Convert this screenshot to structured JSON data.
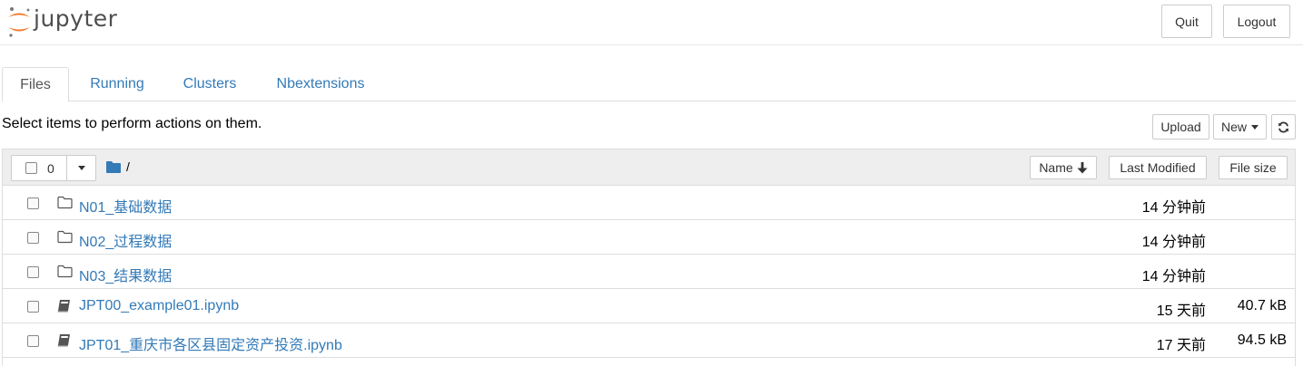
{
  "app": {
    "logo_text": "jupyter",
    "colors": {
      "logo_orange": "#f37726",
      "logo_gray": "#767677",
      "link_blue": "#337ab7"
    }
  },
  "header": {
    "quit_label": "Quit",
    "logout_label": "Logout"
  },
  "tabs": [
    {
      "label": "Files",
      "active": true
    },
    {
      "label": "Running",
      "active": false
    },
    {
      "label": "Clusters",
      "active": false
    },
    {
      "label": "Nbextensions",
      "active": false
    }
  ],
  "toolbar": {
    "hint": "Select items to perform actions on them.",
    "upload_label": "Upload",
    "new_label": "New",
    "refresh_icon": "refresh-icon"
  },
  "list_header": {
    "selected_count": "0",
    "breadcrumb": "/",
    "sort_name_label": "Name",
    "sort_lastmod_label": "Last Modified",
    "sort_size_label": "File size"
  },
  "files": [
    {
      "name": "N01_基础数据",
      "type": "folder",
      "modified": "14 分钟前",
      "size": ""
    },
    {
      "name": "N02_过程数据",
      "type": "folder",
      "modified": "14 分钟前",
      "size": ""
    },
    {
      "name": "N03_结果数据",
      "type": "folder",
      "modified": "14 分钟前",
      "size": ""
    },
    {
      "name": "JPT00_example01.ipynb",
      "type": "notebook",
      "modified": "15 天前",
      "size": "40.7 kB"
    },
    {
      "name": "JPT01_重庆市各区县固定资产投资.ipynb",
      "type": "notebook",
      "modified": "17 天前",
      "size": "94.5 kB"
    }
  ]
}
